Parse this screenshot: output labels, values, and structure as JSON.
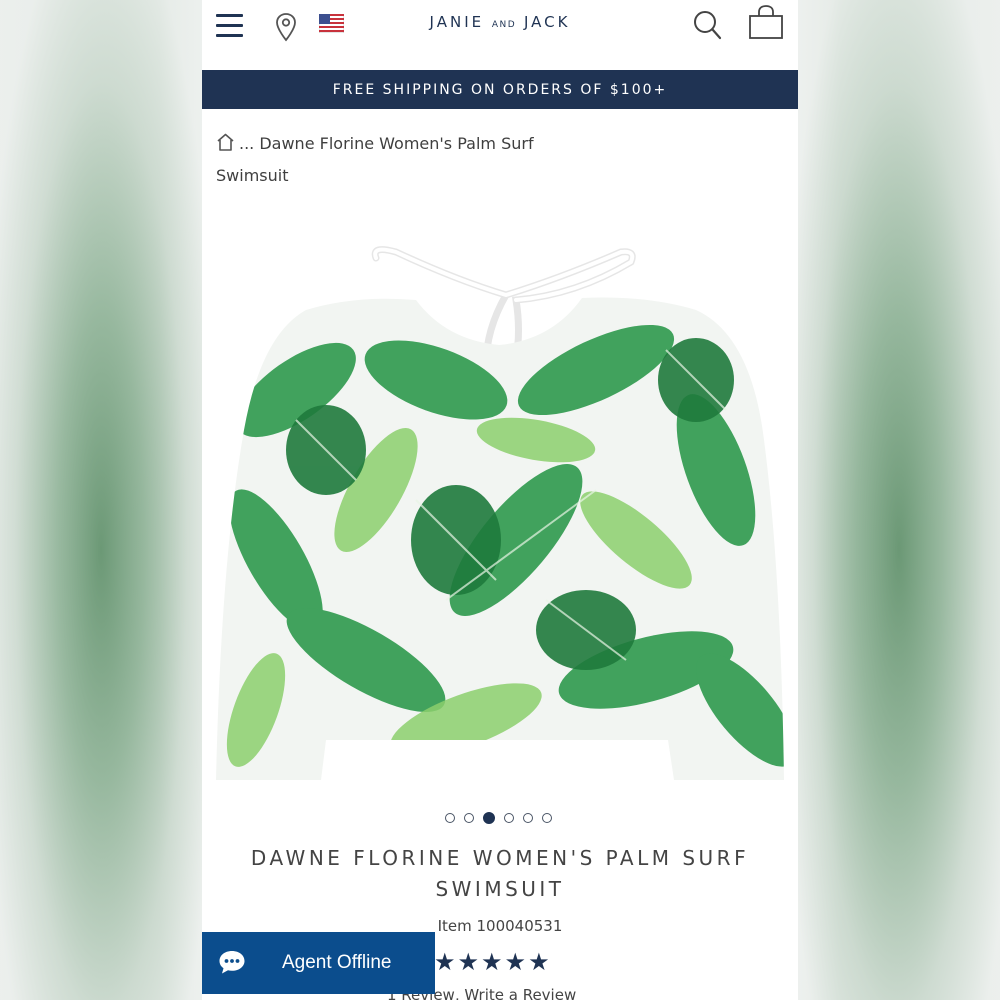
{
  "header": {
    "brand_main_1": "JANIE",
    "brand_small": "AND",
    "brand_main_2": "JACK",
    "icons": [
      "menu-icon",
      "location-pin-icon",
      "us-flag-icon",
      "search-icon",
      "shopping-bag-icon"
    ]
  },
  "banner": {
    "text": "FREE SHIPPING ON ORDERS OF $100+"
  },
  "breadcrumb": {
    "text": "... Dawne Florine Women's Palm Surf Swimsuit"
  },
  "carousel": {
    "count": 6,
    "active_index": 2
  },
  "product": {
    "title": "DAWNE FLORINE WOMEN'S PALM SURF SWIMSUIT",
    "item": "Item 100040531",
    "rating_stars": "★★★★★",
    "rating": 5,
    "reviews_link": "1 Review, Write a Review"
  },
  "chat": {
    "label": "Agent Offline"
  },
  "colors": {
    "navy": "#1f3353",
    "chat_blue": "#0b4d8d",
    "leaf_green": "#2e9a4d"
  }
}
